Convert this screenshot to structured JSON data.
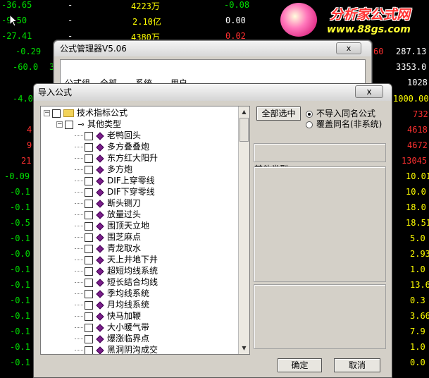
{
  "background": {
    "rows": [
      {
        "c1": "-36.65",
        "c2": "-",
        "c3": "4223万",
        "c4": "-0.08"
      },
      {
        "c1": "-9.50",
        "c2": "-",
        "c3": "2.10亿",
        "c4": "0.00"
      },
      {
        "c1": "-27.41",
        "c2": "-",
        "c3": "4380万",
        "c4": "0.02"
      }
    ],
    "left_values": [
      "-0.29",
      "-60.0",
      "-4.0",
      "4",
      "9",
      "21",
      "-0.09",
      "-0.1",
      "-0.1",
      "-0.5",
      "-0.1",
      "-0.0",
      "-0.1",
      "-0.1",
      "-0.1",
      "-0.1",
      "-0.1",
      "-0.1",
      "-0.1",
      "-0.1"
    ],
    "left_col2_value": "3",
    "right_col1": [
      "60"
    ],
    "right_values": [
      "287.13",
      "3353.0",
      "1028",
      "1000.00",
      "732",
      "4618",
      "4672",
      "13045",
      "10.01",
      "10.0",
      "18.0",
      "18.51",
      "5.0",
      "2.93",
      "1.0",
      "13.6",
      "0.3",
      "3.66",
      "7.9",
      "1.0",
      "0.0"
    ],
    "logo": {
      "title": "分析家公式网",
      "url": "www.88gs.com"
    }
  },
  "back_window": {
    "title": "公式管理器V5.06",
    "close_label": "x",
    "tabs": [
      "公式组",
      "全部",
      "系统",
      "用户"
    ]
  },
  "dialog": {
    "title": "导入公式",
    "close_label": "x",
    "tree": {
      "root": "技术指标公式",
      "group": "其他类型",
      "items": [
        "老鸭回头",
        "多方叠叠炮",
        "东方红大阳升",
        "多方炮",
        "DIF上穿零线",
        "DIF下穿零线",
        "断头铡刀",
        "放量过头",
        "围顶天立地",
        "围芝麻点",
        "青龙取水",
        "天上井地下井",
        "超短均线系统",
        "短长结合均线",
        "季均线系统",
        "月均线系统",
        "快马加鞭",
        "大小暖气带",
        "爆涨临界点",
        "黑洞阴沟成交"
      ]
    },
    "select_all_label": "全部选中",
    "radio_options": [
      {
        "label": "不导入同名公式",
        "checked": true
      },
      {
        "label": "覆盖同名(非系统)",
        "checked": false
      }
    ],
    "category_label": "其他类型",
    "ok_label": "确定",
    "cancel_label": "取消"
  },
  "colors": {
    "negative": "#00e000",
    "positive": "#ff3030",
    "neutral": "#ffffff",
    "amount": "#ffff00"
  }
}
